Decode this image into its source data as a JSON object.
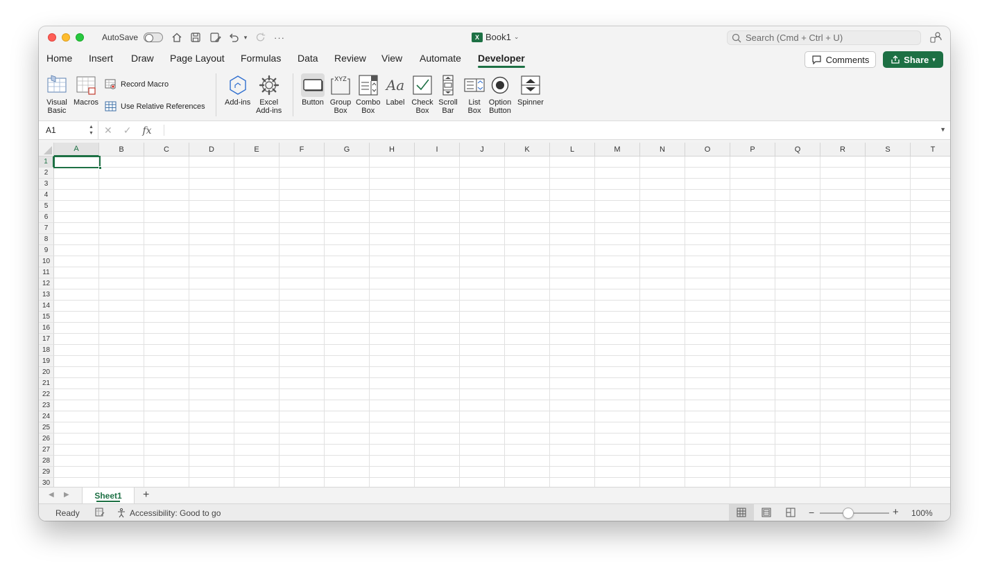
{
  "titlebar": {
    "autosave_label": "AutoSave",
    "document_title": "Book1",
    "search_placeholder": "Search (Cmd + Ctrl + U)"
  },
  "ribbon_tabs": [
    "Home",
    "Insert",
    "Draw",
    "Page Layout",
    "Formulas",
    "Data",
    "Review",
    "View",
    "Automate",
    "Developer"
  ],
  "active_tab": "Developer",
  "actions": {
    "comments_label": "Comments",
    "share_label": "Share"
  },
  "developer_ribbon": {
    "visual_basic": "Visual\nBasic",
    "macros": "Macros",
    "record_macro": "Record Macro",
    "use_relative_references": "Use Relative References",
    "add_ins": "Add-ins",
    "excel_add_ins": "Excel\nAdd-ins",
    "button": "Button",
    "group_box": "Group\nBox",
    "combo_box": "Combo\nBox",
    "label": "Label",
    "check_box": "Check\nBox",
    "scroll_bar": "Scroll\nBar",
    "list_box": "List\nBox",
    "option_button": "Option\nButton",
    "spinner": "Spinner",
    "group_box_icon_text": "XYZ",
    "label_icon_text": "Aa"
  },
  "formula_bar": {
    "name_box": "A1",
    "formula": "",
    "fx_label": "fx"
  },
  "sheet": {
    "columns": [
      "A",
      "B",
      "C",
      "D",
      "E",
      "F",
      "G",
      "H",
      "I",
      "J",
      "K",
      "L",
      "M",
      "N",
      "O",
      "P",
      "Q",
      "R",
      "S",
      "T"
    ],
    "rows": [
      "1",
      "2",
      "3",
      "4",
      "5",
      "6",
      "7",
      "8",
      "9",
      "10",
      "11",
      "12",
      "13",
      "14",
      "15",
      "16",
      "17",
      "18",
      "19",
      "20",
      "21",
      "22",
      "23",
      "24",
      "25",
      "26",
      "27",
      "28",
      "29",
      "30"
    ],
    "selected_cell": "A1"
  },
  "sheet_tabs": {
    "tabs": [
      "Sheet1"
    ],
    "active": "Sheet1"
  },
  "status": {
    "ready": "Ready",
    "accessibility": "Accessibility: Good to go",
    "zoom": "100%",
    "zoom_level": 1.0
  },
  "colors": {
    "accent": "#1d7044",
    "close": "#ff5f57",
    "minimize": "#febc2e",
    "maximize": "#28c840"
  }
}
